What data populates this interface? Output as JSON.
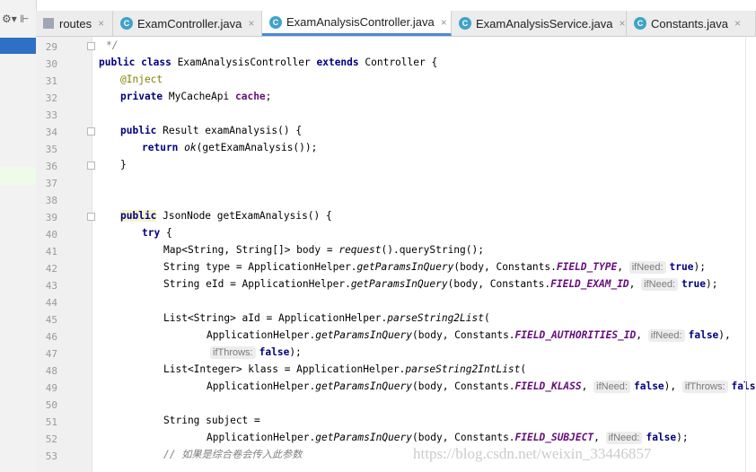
{
  "toolbar": {
    "settings_glyph": "⚙▾",
    "hide_glyph": "⊩"
  },
  "tabs": [
    {
      "label": "routes",
      "icon": "file-icon",
      "active": false
    },
    {
      "label": "ExamController.java",
      "icon": "class-icon",
      "active": false
    },
    {
      "label": "ExamAnalysisController.java",
      "icon": "class-icon",
      "active": true
    },
    {
      "label": "ExamAnalysisService.java",
      "icon": "class-icon",
      "active": false
    },
    {
      "label": "Constants.java",
      "icon": "class-icon",
      "active": false
    }
  ],
  "close_glyph": "×",
  "line_numbers": [
    "29",
    "30",
    "31",
    "32",
    "33",
    "34",
    "35",
    "36",
    "37",
    "38",
    "39",
    "40",
    "41",
    "42",
    "43",
    "44",
    "45",
    "46",
    "47",
    "48",
    "49",
    "50",
    "51",
    "52",
    "53"
  ],
  "code": {
    "l29": "*/",
    "l30_kw1": "public class",
    "l30_name": " ExamAnalysisController ",
    "l30_kw2": "extends",
    "l30_rest": " Controller {",
    "l31": "@Inject",
    "l32_kw": "private",
    "l32_type": " MyCacheApi ",
    "l32_fld": "cache",
    "l32_end": ";",
    "l34_kw": "public",
    "l34_rest": " Result examAnalysis() {",
    "l35_kw": "return",
    "l35_sp": " ",
    "l35_it": "ok",
    "l35_rest": "(getExamAnalysis());",
    "l36": "}",
    "l39_kw": "public",
    "l39_rest": " JsonNode getExamAnalysis() {",
    "l40_kw": "try",
    "l40_rest": " {",
    "l41_a": "Map<String, String[]> body = ",
    "l41_it": "request",
    "l41_b": "().queryString();",
    "l42_a": "String type = ApplicationHelper.",
    "l42_it": "getParamsInQuery",
    "l42_b": "(body, Constants.",
    "l42_f": "FIELD_TYPE",
    "l42_c": ", ",
    "l42_h": "ifNeed:",
    "l42_v": "true",
    "l42_e": ");",
    "l43_a": "String eId = ApplicationHelper.",
    "l43_it": "getParamsInQuery",
    "l43_b": "(body, Constants.",
    "l43_f": "FIELD_EXAM_ID",
    "l43_c": ", ",
    "l43_h": "ifNeed:",
    "l43_v": "true",
    "l43_e": ");",
    "l45_a": "List<String> aId = ApplicationHelper.",
    "l45_it": "parseString2List",
    "l45_b": "(",
    "l46_a": "ApplicationHelper.",
    "l46_it": "getParamsInQuery",
    "l46_b": "(body, Constants.",
    "l46_f": "FIELD_AUTHORITIES_ID",
    "l46_c": ", ",
    "l46_h": "ifNeed:",
    "l46_v": "false",
    "l46_e": "),",
    "l47_h": "ifThrows:",
    "l47_v": "false",
    "l47_e": ");",
    "l48_a": "List<Integer> klass = ApplicationHelper.",
    "l48_it": "parseString2IntList",
    "l48_b": "(",
    "l49_a": "ApplicationHelper.",
    "l49_it": "getParamsInQuery",
    "l49_b": "(body, Constants.",
    "l49_f": "FIELD_KLASS",
    "l49_c": ", ",
    "l49_h": "ifNeed:",
    "l49_v": "false",
    "l49_d": "), ",
    "l49_h2": "ifThrows:",
    "l49_v2": "false",
    "l49_e": ");",
    "l51": "String subject =",
    "l52_a": "ApplicationHelper.",
    "l52_it": "getParamsInQuery",
    "l52_b": "(body, Constants.",
    "l52_f": "FIELD_SUBJECT",
    "l52_c": ", ",
    "l52_h": "ifNeed:",
    "l52_v": "false",
    "l52_e": ");",
    "l53": "// 如果是综合卷会传入此参数"
  },
  "watermark": "https://blog.csdn.net/weixin_33446857",
  "colors": {
    "keyword": "#000080",
    "annotation": "#808000",
    "field": "#660e7a",
    "comment": "#808080",
    "active_tab_underline": "#4a88d8",
    "class_icon": "#3fa3c9"
  }
}
